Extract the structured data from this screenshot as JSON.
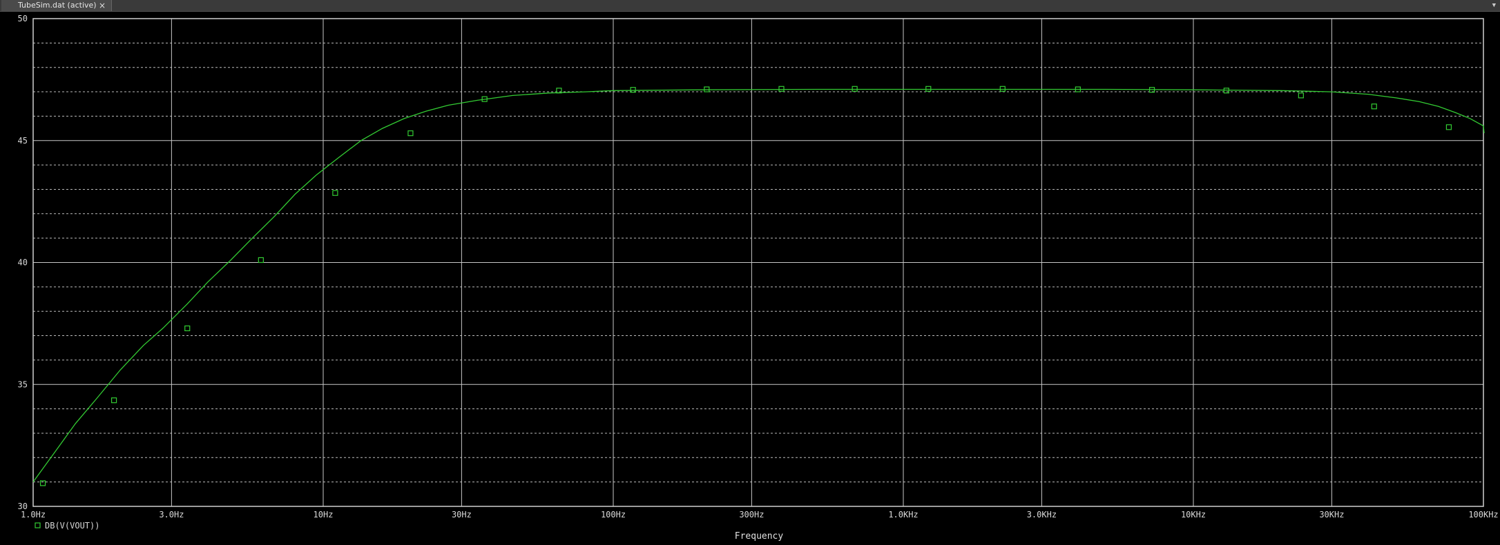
{
  "window": {
    "tab_title": "TubeSim.dat (active)",
    "tab_close_glyph": "×",
    "menu_glyph": "▼"
  },
  "colors": {
    "background": "#000000",
    "frame": "#d0d0d0",
    "grid_major": "#c8c8c8",
    "grid_minor": "#bdbdbd",
    "trace": "#33cc33",
    "text": "#d9d9d9"
  },
  "chart_data": {
    "type": "line",
    "xscale": "log",
    "xlim": [
      1,
      100000
    ],
    "ylim": [
      30,
      50
    ],
    "xlabel": "Frequency",
    "ylabel": "",
    "grid": true,
    "y_major_ticks": [
      {
        "value": 30,
        "label": "30"
      },
      {
        "value": 35,
        "label": "35"
      },
      {
        "value": 40,
        "label": "40"
      },
      {
        "value": 45,
        "label": "45"
      },
      {
        "value": 50,
        "label": "50"
      }
    ],
    "y_minor_ticks": [
      31,
      32,
      33,
      34,
      36,
      37,
      38,
      39,
      41,
      42,
      43,
      44,
      46,
      47,
      48,
      49
    ],
    "x_ticks": [
      {
        "value": 1,
        "label": "1.0Hz"
      },
      {
        "value": 3,
        "label": "3.0Hz"
      },
      {
        "value": 10,
        "label": "10Hz"
      },
      {
        "value": 30,
        "label": "30Hz"
      },
      {
        "value": 100,
        "label": "100Hz"
      },
      {
        "value": 300,
        "label": "300Hz"
      },
      {
        "value": 1000,
        "label": "1.0KHz"
      },
      {
        "value": 3000,
        "label": "3.0KHz"
      },
      {
        "value": 10000,
        "label": "10KHz"
      },
      {
        "value": 30000,
        "label": "30KHz"
      },
      {
        "value": 100000,
        "label": "100KHz"
      }
    ],
    "legend_position": "bottom-left",
    "series": [
      {
        "name": "DB(V(VOUT))",
        "marker": "square",
        "x": [
          1.0,
          1.2,
          1.4,
          1.65,
          2.0,
          2.4,
          2.8,
          3.4,
          4.0,
          4.8,
          5.7,
          6.8,
          8.0,
          9.5,
          11.3,
          13.5,
          16.0,
          19.0,
          22.6,
          27.0,
          34.0,
          45.0,
          60.0,
          80.0,
          100.0,
          200.0,
          500.0,
          1000.0,
          2000.0,
          5000.0,
          10000.0,
          20000.0,
          30000.0,
          40000.0,
          50000.0,
          60000.0,
          70000.0,
          80000.0,
          90000.0,
          100000.0,
          111000.0
        ],
        "y": [
          31.0,
          32.3,
          33.4,
          34.4,
          35.6,
          36.6,
          37.3,
          38.3,
          39.2,
          40.1,
          41.0,
          41.9,
          42.8,
          43.6,
          44.3,
          45.0,
          45.5,
          45.9,
          46.2,
          46.45,
          46.65,
          46.85,
          46.95,
          47.0,
          47.05,
          47.08,
          47.1,
          47.1,
          47.1,
          47.1,
          47.08,
          47.05,
          47.0,
          46.9,
          46.75,
          46.6,
          46.4,
          46.15,
          45.9,
          45.6,
          45.3
        ],
        "marker_x": [
          1.08,
          1.9,
          3.4,
          6.1,
          11.0,
          20.0,
          36.0,
          65.0,
          117.0,
          210.0,
          380.0,
          680.0,
          1220.0,
          2200.0,
          4000.0,
          7200.0,
          13000.0,
          23500.0,
          42000.0,
          76000.0
        ],
        "marker_y": [
          30.95,
          34.35,
          37.3,
          40.1,
          42.85,
          45.3,
          46.7,
          47.05,
          47.08,
          47.1,
          47.12,
          47.12,
          47.12,
          47.12,
          47.1,
          47.08,
          47.05,
          46.85,
          46.4,
          45.55
        ]
      }
    ]
  }
}
